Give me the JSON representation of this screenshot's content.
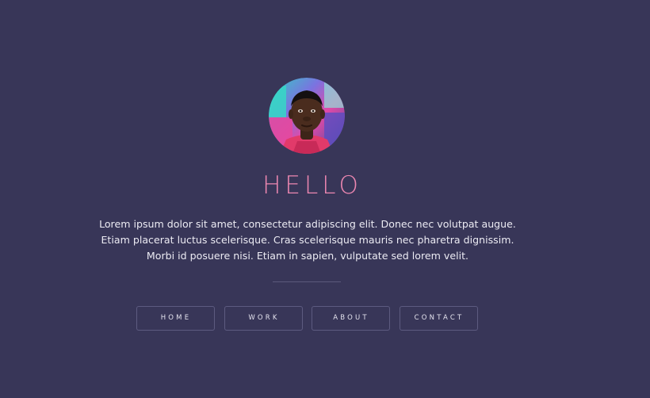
{
  "profile": {
    "avatar_icon": "profile-photo"
  },
  "hero": {
    "title": "HELLO",
    "bio": "Lorem ipsum dolor sit amet, consectetur adipiscing elit. Donec nec volutpat augue. Etiam placerat luctus scelerisque. Cras scelerisque mauris nec pharetra dignissim. Morbi id posuere nisi. Etiam in sapien, vulputate sed lorem velit."
  },
  "nav": {
    "items": [
      {
        "label": "HOME"
      },
      {
        "label": "WORK"
      },
      {
        "label": "ABOUT"
      },
      {
        "label": "CONTACT"
      }
    ]
  },
  "colors": {
    "background": "#383658",
    "accent": "#ec87b1",
    "text": "#ecebf3",
    "border": "#5d5b80"
  }
}
